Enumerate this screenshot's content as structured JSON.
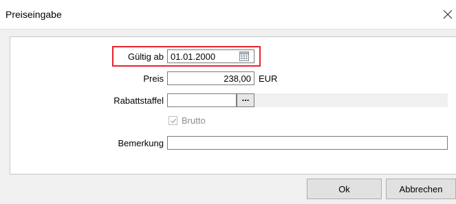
{
  "window": {
    "title": "Preiseingabe"
  },
  "form": {
    "valid_from_label": "Gültig ab",
    "valid_from_value": "01.01.2000",
    "price_label": "Preis",
    "price_value": "238,00",
    "currency": "EUR",
    "discount_scale_label": "Rabattstaffel",
    "discount_scale_value": "",
    "discount_button_label": "...",
    "brutto_label": "Brutto",
    "brutto_checked": true,
    "remark_label": "Bemerkung",
    "remark_value": ""
  },
  "buttons": {
    "ok": "Ok",
    "cancel": "Abbrechen"
  },
  "colors": {
    "highlight": "#e8222c",
    "panel_bg": "#ffffff",
    "window_bg": "#f0f0f0"
  },
  "icons": {
    "close": "close-icon",
    "calendar": "calendar-icon",
    "check": "checkmark-icon"
  }
}
